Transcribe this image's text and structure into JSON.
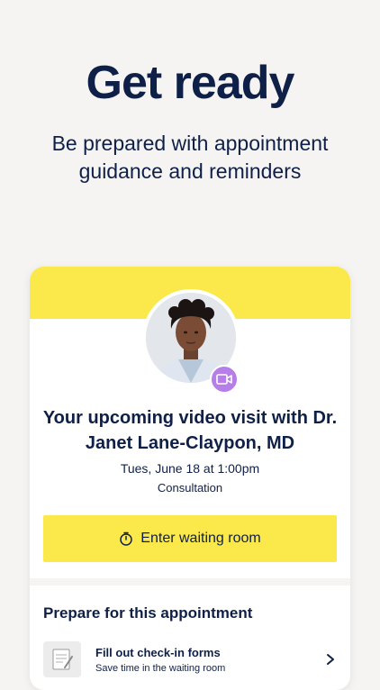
{
  "hero": {
    "title": "Get ready",
    "subtitle": "Be prepared with appointment guidance and reminders"
  },
  "appointment": {
    "title": "Your upcoming video visit with Dr. Janet Lane-Claypon, MD",
    "datetime": "Tues, June 18 at 1:00pm",
    "type": "Consultation",
    "enter_button": "Enter waiting room",
    "avatar_icon": "doctor-photo",
    "badge_icon": "video-camera-icon"
  },
  "prepare": {
    "heading": "Prepare for this appointment",
    "tasks": [
      {
        "title": "Fill out check-in forms",
        "subtitle": "Save time in the waiting room",
        "icon": "form-clipboard-icon"
      }
    ]
  },
  "colors": {
    "accent_yellow": "#fbe84a",
    "navy": "#0f2048",
    "badge_purple": "#b57ee8",
    "background": "#f5f4f2"
  }
}
